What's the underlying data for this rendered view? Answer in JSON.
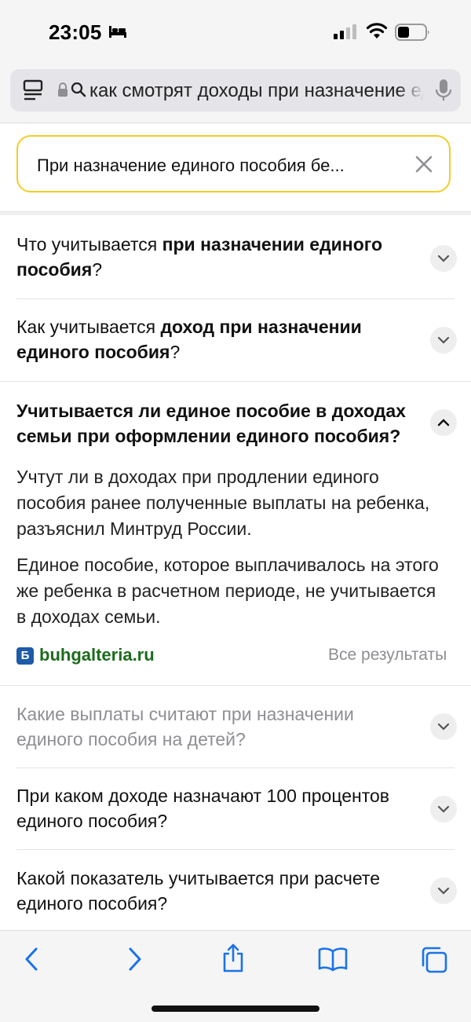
{
  "status_bar": {
    "time": "23:05",
    "icons": [
      "bed-icon",
      "signal-icon",
      "wifi-icon",
      "battery-icon"
    ]
  },
  "browser": {
    "address_text": "как смотрят доходы при назначение единого пособия",
    "icons": [
      "reader-icon",
      "lock-icon",
      "search-icon",
      "mic-icon"
    ]
  },
  "search": {
    "query": "При назначение единого пособия бе..."
  },
  "faq": {
    "q1": {
      "pre": "Что учитывается ",
      "bold": "при назначении единого пособия",
      "post": "?"
    },
    "q2": {
      "pre": "Как учитывается ",
      "bold": "доход при назначении единого пособия",
      "post": "?"
    },
    "expanded": {
      "title": "Учитывается ли единое пособие в доходах семьи при оформлении единого пособия?",
      "p1": "Учтут ли в доходах при продлении единого пособия ранее полученные выплаты на ребенка, разъяснил Минтруд России.",
      "p2": "Единое пособие, которое выплачивалось на этого же ребенка в расчетном периоде, не учитывается в доходах семьи.",
      "source_logo": "Б",
      "source": "buhgalteria.ru",
      "all_results": "Все результаты"
    },
    "q3": "Какие выплаты считают при назначении единого пособия на детей?",
    "q4": "При каком доходе назначают 100 процентов единого пособия?",
    "q5": "Какой показатель учитывается при расчете единого пособия?"
  },
  "toolbar": {
    "icons": [
      "back-icon",
      "forward-icon",
      "share-icon",
      "bookmarks-icon",
      "tabs-icon"
    ]
  },
  "colors": {
    "search_border": "#f2cd27",
    "source_link": "#1d6b1d",
    "source_logo_bg": "#1e5aa7",
    "toolbar_icon": "#1a73e8"
  }
}
